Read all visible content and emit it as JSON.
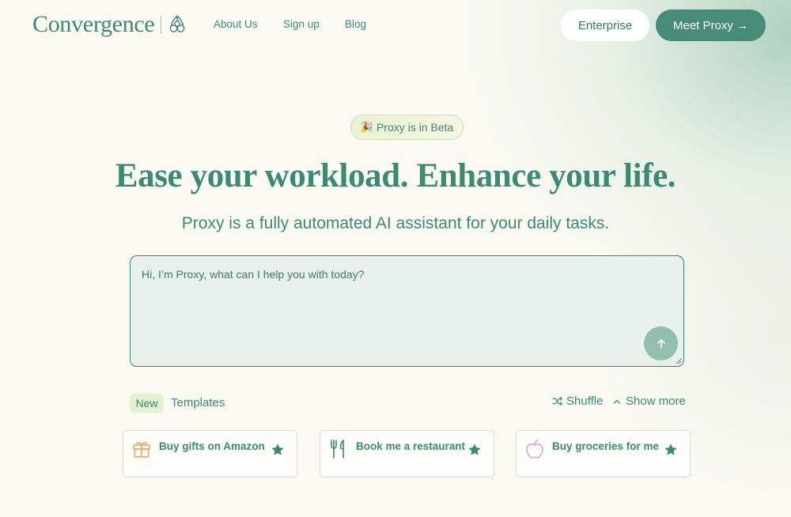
{
  "header": {
    "logo_text": "Convergence",
    "nav": [
      {
        "label": "About Us"
      },
      {
        "label": "Sign up"
      },
      {
        "label": "Blog"
      }
    ],
    "enterprise_label": "Enterprise",
    "meet_label": "Meet Proxy →"
  },
  "hero": {
    "beta_emoji": "🎉",
    "beta_text": "Proxy is in Beta",
    "headline": "Ease your workload. Enhance your life.",
    "subhead": "Proxy is a fully automated AI assistant for your daily tasks."
  },
  "prompt": {
    "placeholder": "Hi, I’m Proxy, what can I help you with today?",
    "value": ""
  },
  "templates": {
    "new_badge": "New",
    "label": "Templates",
    "shuffle_label": "Shuffle",
    "show_more_label": "Show more",
    "cards": [
      {
        "label": "Buy gifts on Amazon",
        "icon": "gift-icon",
        "icon_color": "#f0a15c"
      },
      {
        "label": "Book me a restaurant",
        "icon": "fork-knife-icon",
        "icon_color": "#3b8a72"
      },
      {
        "label": "Buy groceries for me",
        "icon": "apple-icon",
        "icon_color": "#d8a6e0"
      }
    ]
  },
  "colors": {
    "brand_green": "#3b8a72",
    "button_green": "#468c76",
    "send_button": "#93bfae",
    "background": "#fafaf3"
  }
}
